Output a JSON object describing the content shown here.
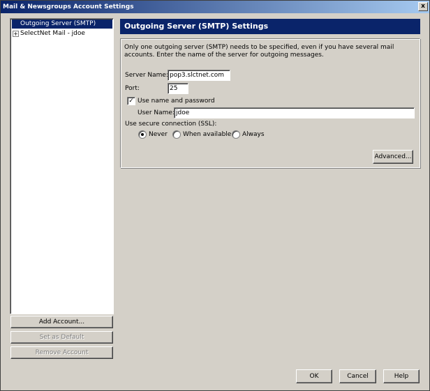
{
  "window": {
    "title": "Mail & Newsgroups Account Settings",
    "close_glyph": "x"
  },
  "tree": {
    "items": [
      {
        "label": "Outgoing Server (SMTP)",
        "selected": true
      },
      {
        "label": "SelectNet Mail - jdoe",
        "expander": "+"
      }
    ]
  },
  "left_buttons": {
    "add_account": "Add Account...",
    "set_default": "Set as Default",
    "remove_account": "Remove Account"
  },
  "panel": {
    "title": "Outgoing Server (SMTP) Settings",
    "description": "Only one outgoing server (SMTP) needs to be specified, even if you have several mail accounts. Enter the name of the server for outgoing messages.",
    "server_name_label": "Server Name:",
    "server_name_value": "pop3.slctnet.com",
    "port_label": "Port:",
    "port_value": "25",
    "use_name_password_label": "Use name and password",
    "use_name_password_checked": true,
    "check_glyph": "✓",
    "user_name_label": "User Name:",
    "user_name_value": "jdoe",
    "ssl_label": "Use secure connection (SSL):",
    "ssl_options": [
      {
        "label": "Never",
        "checked": true
      },
      {
        "label": "When available",
        "checked": false
      },
      {
        "label": "Always",
        "checked": false
      }
    ],
    "advanced_button": "Advanced..."
  },
  "footer_buttons": {
    "ok": "OK",
    "cancel": "Cancel",
    "help": "Help"
  }
}
